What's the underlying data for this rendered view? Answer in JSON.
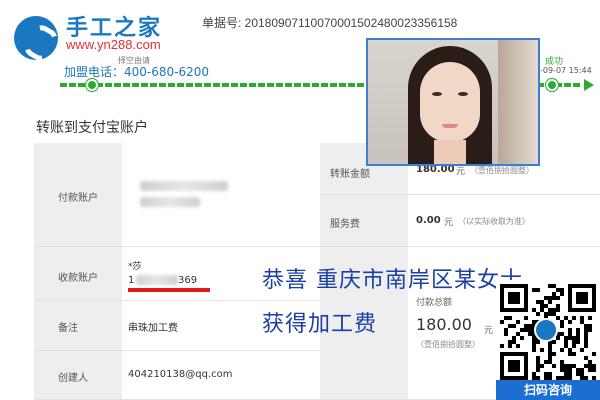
{
  "header": {
    "brand_name": "手工之家",
    "site_url": "www.yn288.com",
    "tagline": "择空由请",
    "hotline": "加盟电话：400-680-6200",
    "order_number": "单据号: 20180907110070001502480023356158"
  },
  "progress": {
    "status_label": "成功",
    "status_time": "-09-07 15:44"
  },
  "section_title": "转账到支付宝账户",
  "table": {
    "payer_label": "付款账户",
    "amount_label": "转账金额",
    "amount_value": "180.00",
    "amount_unit": "元",
    "amount_words": "（壹佰捌拾圆整）",
    "fee_label": "服务费",
    "fee_value": "0.00",
    "fee_unit": "元",
    "fee_note": "（以实际收取为准）",
    "payee_label": "收款账户",
    "payee_name": "*莎",
    "payee_account_partial": "1",
    "payee_account_tail": "369",
    "memo_label": "备注",
    "memo_value": "串珠加工费",
    "total_label": "付款总额",
    "total_value": "180.00",
    "total_unit": "元",
    "total_words": "（壹佰捌拾圆整）",
    "creator_label": "创建人",
    "creator_value": "404210138@qq.com"
  },
  "overlay": {
    "line1": "恭喜 重庆市南岸区某女士",
    "line2": "获得加工费"
  },
  "qr": {
    "caption": "扫码咨询"
  },
  "colors": {
    "brand_blue": "#1a78c2",
    "progress_green": "#27ae2e",
    "overlay_blue": "#1a3fa8",
    "qr_caption_bg": "#1a6fd1"
  }
}
